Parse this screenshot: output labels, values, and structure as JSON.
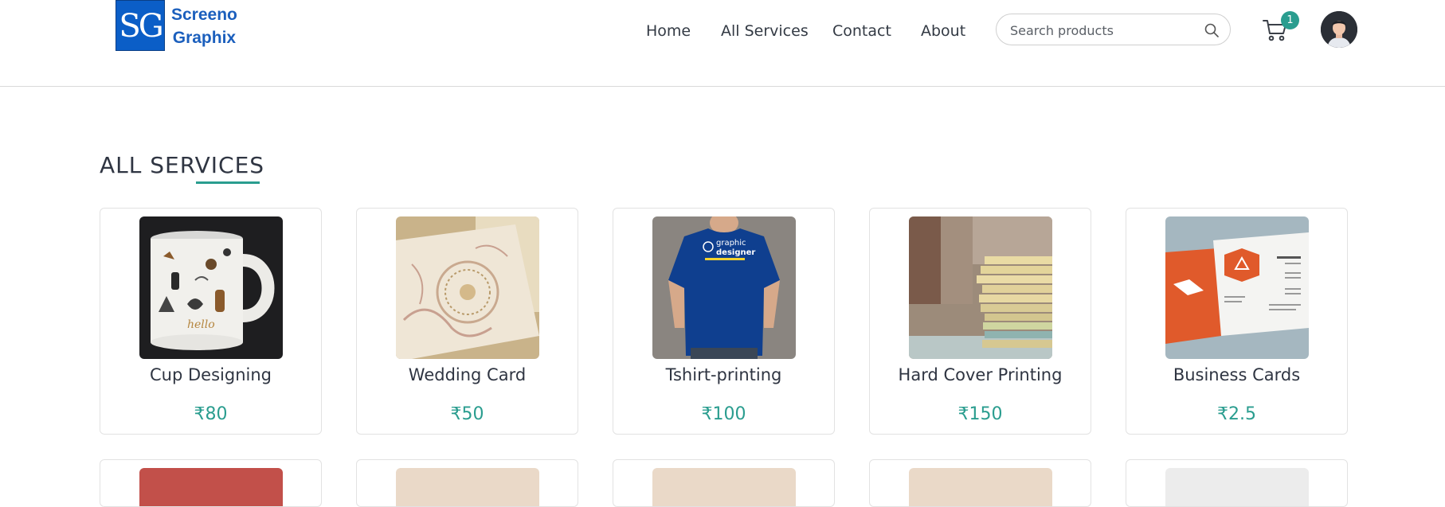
{
  "brand": {
    "logo_mark": "SG",
    "name_line1": "Screeno",
    "name_line2": "Graphix"
  },
  "nav": [
    {
      "label": "Home"
    },
    {
      "label": "All Services"
    },
    {
      "label": "Contact"
    },
    {
      "label": "About"
    }
  ],
  "search": {
    "placeholder": "Search products",
    "value": ""
  },
  "cart": {
    "count": "1"
  },
  "section": {
    "title": "ALL SERVICES"
  },
  "products": [
    {
      "name": "Cup Designing",
      "price": "₹80"
    },
    {
      "name": "Wedding Card",
      "price": "₹50"
    },
    {
      "name": "Tshirt-printing",
      "price": "₹100"
    },
    {
      "name": "Hard Cover Printing",
      "price": "₹150"
    },
    {
      "name": "Business Cards",
      "price": "₹2.5"
    }
  ],
  "tshirt_print": {
    "line1": "graphic",
    "line2": "designer"
  },
  "colors": {
    "accent": "#2a9d8f",
    "brand": "#0b5ec7",
    "text": "#2f3542"
  }
}
